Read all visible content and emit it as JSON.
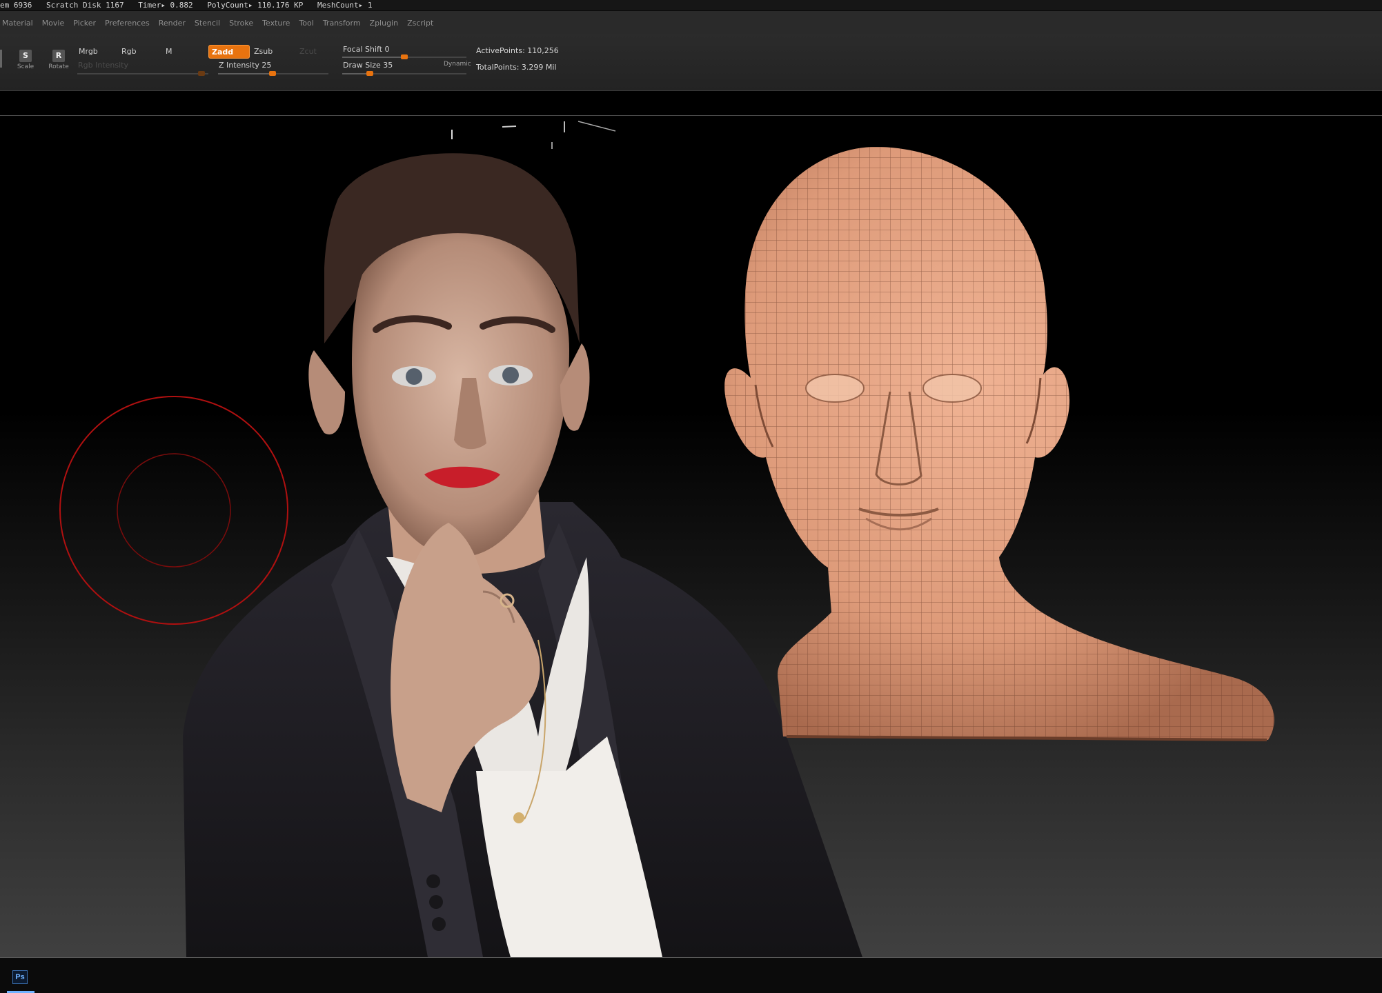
{
  "status": {
    "mem": "em 6936",
    "scratch": "Scratch Disk 1167",
    "timer": "Timer▸ 0.882",
    "polycount": "PolyCount▸ 110.176 KP",
    "meshcount": "MeshCount▸ 1"
  },
  "menu": [
    "Material",
    "Movie",
    "Picker",
    "Preferences",
    "Render",
    "Stencil",
    "Stroke",
    "Texture",
    "Tool",
    "Transform",
    "Zplugin",
    "Zscript"
  ],
  "shelf": {
    "scale": {
      "label": "Scale",
      "glyph": "S"
    },
    "rotate": {
      "label": "Rotate",
      "glyph": "R"
    },
    "mrgb": "Mrgb",
    "rgb": "Rgb",
    "m": "M",
    "zadd": "Zadd",
    "zsub": "Zsub",
    "zcut": "Zcut",
    "rgb_intensity": "Rgb Intensity",
    "z_intensity": "Z Intensity 25",
    "z_intensity_value": 25,
    "focal_shift": "Focal Shift 0",
    "focal_shift_value": 0,
    "draw_size": "Draw Size 35",
    "draw_size_value": 35,
    "dynamic": "Dynamic",
    "active_points": "ActivePoints: 110,256",
    "total_points": "TotalPoints: 3.299 Mil"
  },
  "taskbar": {
    "ps_label": "Ps"
  },
  "colors": {
    "accent": "#e8730f",
    "brush_cursor": "#b01010",
    "skin": "#e3a183",
    "jacket": "#1f1d22"
  }
}
